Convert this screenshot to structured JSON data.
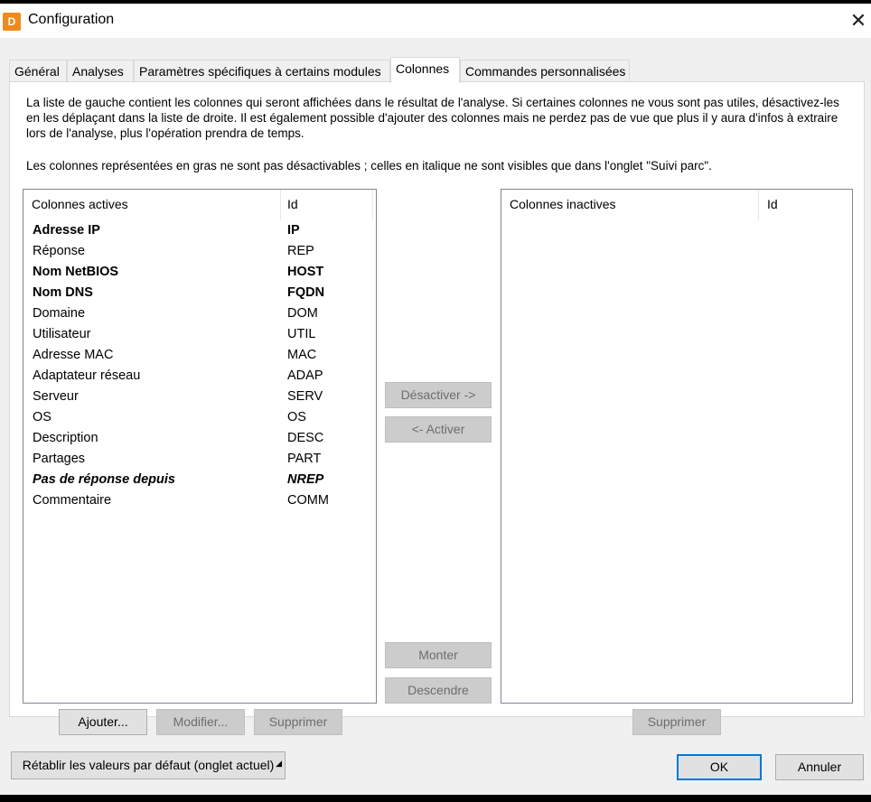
{
  "window": {
    "title": "Configuration",
    "app_icon_letter": "D",
    "close_glyph": "✕"
  },
  "tabs": [
    {
      "label": "Général"
    },
    {
      "label": "Analyses"
    },
    {
      "label": "Paramètres spécifiques à certains modules"
    },
    {
      "label": "Colonnes",
      "active": true
    },
    {
      "label": "Commandes personnalisées"
    }
  ],
  "description": {
    "paragraph1": "La liste de gauche contient les colonnes qui seront affichées dans le résultat de l'analyse. Si certaines colonnes ne vous sont pas utiles, désactivez-les en les déplaçant dans la liste de droite. Il est également possible d'ajouter des colonnes mais ne perdez pas de vue que plus il y aura d'infos à extraire lors de l'analyse, plus l'opération prendra de temps.",
    "paragraph2": "Les colonnes représentées en gras ne sont pas désactivables ; celles en italique ne sont visibles que dans l'onglet \"Suivi parc\"."
  },
  "active_list": {
    "headers": {
      "name": "Colonnes actives",
      "id": "Id"
    },
    "rows": [
      {
        "name": "Adresse IP",
        "id": "IP",
        "style": "bold"
      },
      {
        "name": "Réponse",
        "id": "REP",
        "style": "normal"
      },
      {
        "name": "Nom NetBIOS",
        "id": "HOST",
        "style": "bold"
      },
      {
        "name": "Nom DNS",
        "id": "FQDN",
        "style": "bold"
      },
      {
        "name": "Domaine",
        "id": "DOM",
        "style": "normal"
      },
      {
        "name": "Utilisateur",
        "id": "UTIL",
        "style": "normal"
      },
      {
        "name": "Adresse MAC",
        "id": "MAC",
        "style": "normal"
      },
      {
        "name": "Adaptateur réseau",
        "id": "ADAP",
        "style": "normal"
      },
      {
        "name": "Serveur",
        "id": "SERV",
        "style": "normal"
      },
      {
        "name": "OS",
        "id": "OS",
        "style": "normal"
      },
      {
        "name": "Description",
        "id": "DESC",
        "style": "normal"
      },
      {
        "name": "Partages",
        "id": "PART",
        "style": "normal"
      },
      {
        "name": "Pas de réponse depuis",
        "id": "NREP",
        "style": "bold-italic"
      },
      {
        "name": "Commentaire",
        "id": "COMM",
        "style": "normal"
      }
    ]
  },
  "inactive_list": {
    "headers": {
      "name": "Colonnes inactives",
      "id": "Id"
    },
    "rows": []
  },
  "buttons": {
    "deactivate": "Désactiver ->",
    "activate": "<- Activer",
    "move_up": "Monter",
    "move_down": "Descendre",
    "add": "Ajouter...",
    "modify": "Modifier...",
    "delete_left": "Supprimer",
    "delete_right": "Supprimer",
    "reset": "Rétablir les valeurs par défaut (onglet actuel)",
    "ok": "OK",
    "cancel": "Annuler"
  },
  "colors": {
    "accent": "#0078d7",
    "app_icon": "#f08a1c"
  }
}
